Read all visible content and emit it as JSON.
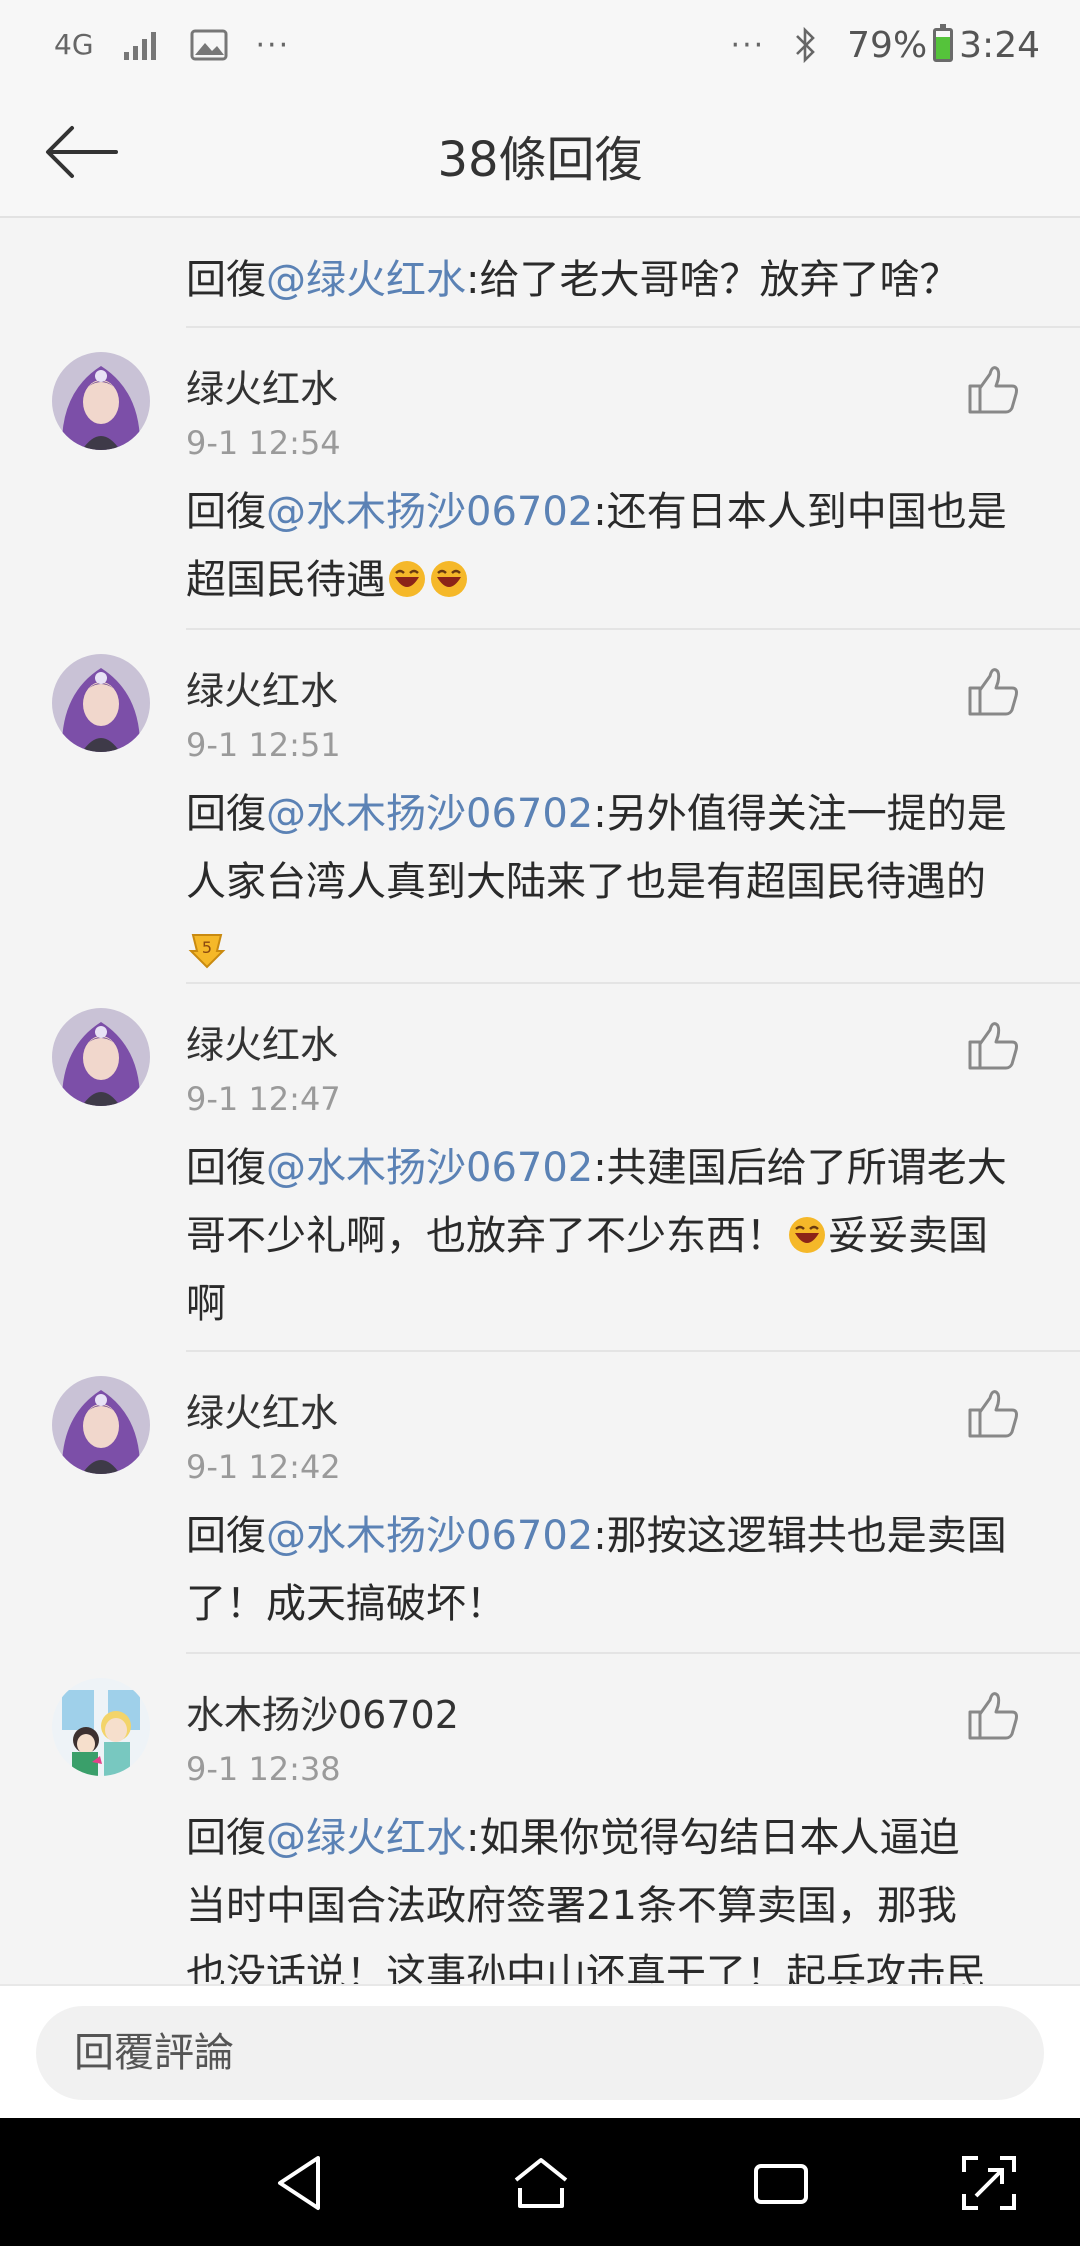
{
  "status_bar": {
    "network": "4G",
    "left_dots": "···",
    "right_dots": "···",
    "battery": "79%",
    "time": "3:24"
  },
  "header": {
    "title": "38條回復"
  },
  "replies": [
    {
      "mention": "@绿火红水",
      "text": ":给了老大哥啥？放弃了啥？"
    },
    {
      "user": "绿火红水",
      "time": "9-1 12:54",
      "prefix": "回復",
      "mention": "@水木扬沙06702",
      "text_1": ":还有日本人到中国也是",
      "text_2": "超国民待遇",
      "emoji": [
        "laughing-emoji",
        "laughing-emoji"
      ]
    },
    {
      "user": "绿火红水",
      "time": "9-1 12:51",
      "prefix": "回復",
      "mention": "@水木扬沙06702",
      "text_1": ":另外值得关注一提的是",
      "text_2": "人家台湾人真到大陆来了也是有超国民待遇的",
      "emoji": [
        "five-point-emoji"
      ]
    },
    {
      "user": "绿火红水",
      "time": "9-1 12:47",
      "prefix": "回復",
      "mention": "@水木扬沙06702",
      "text_1": ":共建国后给了所谓老大",
      "text_2a": "哥不少礼啊，也放弃了不少东西！",
      "text_2b": "妥妥卖国",
      "text_3": "啊",
      "emoji": [
        "laughing-emoji"
      ]
    },
    {
      "user": "绿火红水",
      "time": "9-1 12:42",
      "prefix": "回復",
      "mention": "@水木扬沙06702",
      "text_1": ":那按这逻辑共也是卖国",
      "text_2": "了！成天搞破坏！"
    },
    {
      "user": "水木扬沙06702",
      "time": "9-1 12:38",
      "prefix": "回復",
      "mention": "@绿火红水",
      "text_1": ":如果你觉得勾结日本人逼迫",
      "text_2": "当时中国合法政府签署21条不算卖国，那我",
      "text_3": "也没话说！这事孙中山还真干了！起兵攻击民"
    }
  ],
  "first_reply_prefix": "回復",
  "input": {
    "placeholder": "回覆評論"
  },
  "icons": {
    "back": "back-arrow-icon",
    "like": "thumbs-up-icon",
    "nav": [
      "nav-back-icon",
      "nav-home-icon",
      "nav-recents-icon",
      "nav-screenshot-icon"
    ]
  },
  "colors": {
    "mention": "#5b82b5",
    "background": "#f4f4f4",
    "time": "#9a9a9a"
  }
}
